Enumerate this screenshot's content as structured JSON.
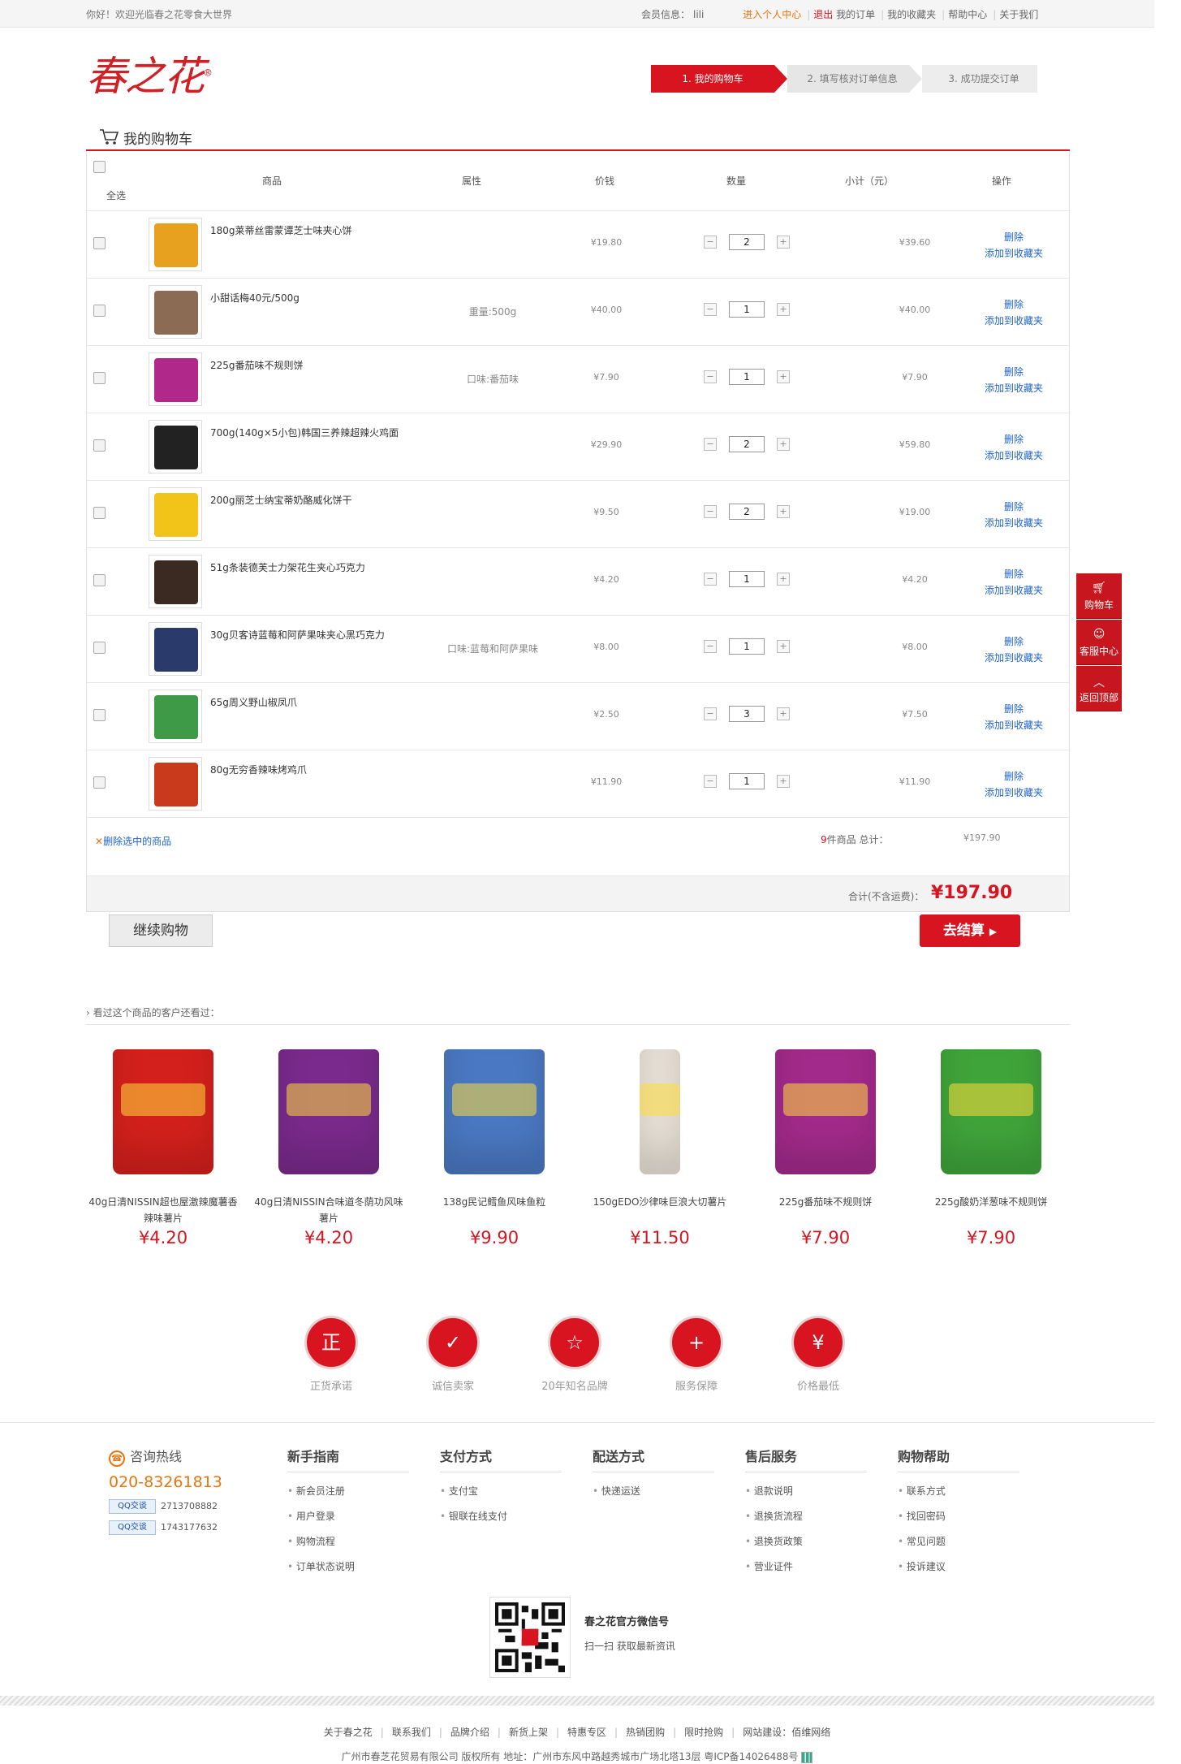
{
  "topbar": {
    "welcome": "你好！欢迎光临春之花零食大世界",
    "member_label": "会员信息：",
    "member_name": "lili",
    "center": "进入个人中心",
    "logout": "退出",
    "orders": "我的订单",
    "favorites": "我的收藏夹",
    "help": "帮助中心",
    "about": "关于我们"
  },
  "logo": {
    "text": "春之花",
    "reg": "®"
  },
  "steps": [
    "1. 我的购物车",
    "2. 填写核对订单信息",
    "3. 成功提交订单"
  ],
  "cart": {
    "title": "我的购物车",
    "headers": {
      "select_all": "全选",
      "product": "商品",
      "attr": "属性",
      "price": "价钱",
      "qty": "数量",
      "subtotal": "小计（元）",
      "ops": "操作"
    },
    "items": [
      {
        "name": "180g莱蒂丝雷蒙谭芝士味夹心饼",
        "attr": "",
        "price": "¥19.80",
        "qty": "2",
        "subtotal": "¥39.60",
        "thumb": "#e8a11e"
      },
      {
        "name": "小甜话梅40元/500g",
        "attr": "重量:500g",
        "price": "¥40.00",
        "qty": "1",
        "subtotal": "¥40.00",
        "thumb": "#8b6b53"
      },
      {
        "name": "225g番茄味不规则饼",
        "attr": "口味:番茄味",
        "price": "¥7.90",
        "qty": "1",
        "subtotal": "¥7.90",
        "thumb": "#b0288a"
      },
      {
        "name": "700g(140g×5小包)韩国三养辣超辣火鸡面",
        "attr": "",
        "price": "¥29.90",
        "qty": "2",
        "subtotal": "¥59.80",
        "thumb": "#222222"
      },
      {
        "name": "200g丽芝士纳宝蒂奶酪威化饼干",
        "attr": "",
        "price": "¥9.50",
        "qty": "2",
        "subtotal": "¥19.00",
        "thumb": "#f2c318"
      },
      {
        "name": "51g条装德芙士力架花生夹心巧克力",
        "attr": "",
        "price": "¥4.20",
        "qty": "1",
        "subtotal": "¥4.20",
        "thumb": "#3a2a22"
      },
      {
        "name": "30g贝客诗蓝莓和阿萨果味夹心黑巧克力",
        "attr": "口味:蓝莓和阿萨果味",
        "price": "¥8.00",
        "qty": "1",
        "subtotal": "¥8.00",
        "thumb": "#2a3a6a"
      },
      {
        "name": "65g周义野山椒凤爪",
        "attr": "",
        "price": "¥2.50",
        "qty": "3",
        "subtotal": "¥7.50",
        "thumb": "#3e9a46"
      },
      {
        "name": "80g无穷香辣味烤鸡爪",
        "attr": "",
        "price": "¥11.90",
        "qty": "1",
        "subtotal": "¥11.90",
        "thumb": "#c93a1c"
      }
    ],
    "op_delete": "删除",
    "op_fav": "添加到收藏夹",
    "delete_selected": "删除选中的商品",
    "count_num": "9",
    "count_text": "件商品  总计：",
    "count_total": "¥197.90",
    "total_label": "合计(不含运费)：",
    "total_value": "¥197.90"
  },
  "buttons": {
    "continue": "继续购物",
    "checkout": "去结算"
  },
  "also_viewed": {
    "title": "看过这个商品的客户还看过：",
    "items": [
      {
        "name": "40g日清NISSIN超也屋激辣魔薯香辣味薯片",
        "price": "¥4.20",
        "color": "#d4201c"
      },
      {
        "name": "40g日清NISSIN合味道冬荫功风味薯片",
        "price": "¥4.20",
        "color": "#7a2a8c"
      },
      {
        "name": "138g民记鳕鱼风味鱼粒",
        "price": "¥9.90",
        "color": "#4a78c2"
      },
      {
        "name": "150gEDO沙律味巨浪大切薯片",
        "price": "¥11.50",
        "color": "#e9e3d8"
      },
      {
        "name": "225g番茄味不规则饼",
        "price": "¥7.90",
        "color": "#a22a8a"
      },
      {
        "name": "225g酸奶洋葱味不规则饼",
        "price": "¥7.90",
        "color": "#3fa43a"
      }
    ]
  },
  "services": [
    {
      "label": "正货承诺",
      "icon": "正"
    },
    {
      "label": "诚信卖家",
      "icon": "✓"
    },
    {
      "label": "20年知名品牌",
      "icon": "☆"
    },
    {
      "label": "服务保障",
      "icon": "+"
    },
    {
      "label": "价格最低",
      "icon": "¥"
    }
  ],
  "footer": {
    "hotline_label": "咨询热线",
    "hotline": "020-83261813",
    "qq_badge": "QQ交谈",
    "qq1": "2713708882",
    "qq2": "1743177632",
    "cols": [
      {
        "title": "新手指南",
        "items": [
          "新会员注册",
          "用户登录",
          "购物流程",
          "订单状态说明"
        ]
      },
      {
        "title": "支付方式",
        "items": [
          "支付宝",
          "银联在线支付"
        ]
      },
      {
        "title": "配送方式",
        "items": [
          "快递运送"
        ]
      },
      {
        "title": "售后服务",
        "items": [
          "退款说明",
          "退换货流程",
          "退换货政策",
          "营业证件"
        ]
      },
      {
        "title": "购物帮助",
        "items": [
          "联系方式",
          "找回密码",
          "常见问题",
          "投诉建议"
        ]
      }
    ],
    "wechat_title": "春之花官方微信号",
    "wechat_sub": "扫一扫  获取最新资讯",
    "links": [
      "关于春之花",
      "联系我们",
      "品牌介绍",
      "新货上架",
      "特惠专区",
      "热销团购",
      "限时抢购",
      "网站建设：佰维网络"
    ],
    "copyright": "广州市春芝花贸易有限公司  版权所有  地址：广州市东风中路越秀城市广场北塔13层  粤ICP备14026488号"
  },
  "side": [
    {
      "label": "购物车",
      "icon": "cart-icon"
    },
    {
      "label": "客服中心",
      "icon": "person-icon"
    },
    {
      "label": "返回顶部",
      "icon": "up-icon"
    }
  ]
}
